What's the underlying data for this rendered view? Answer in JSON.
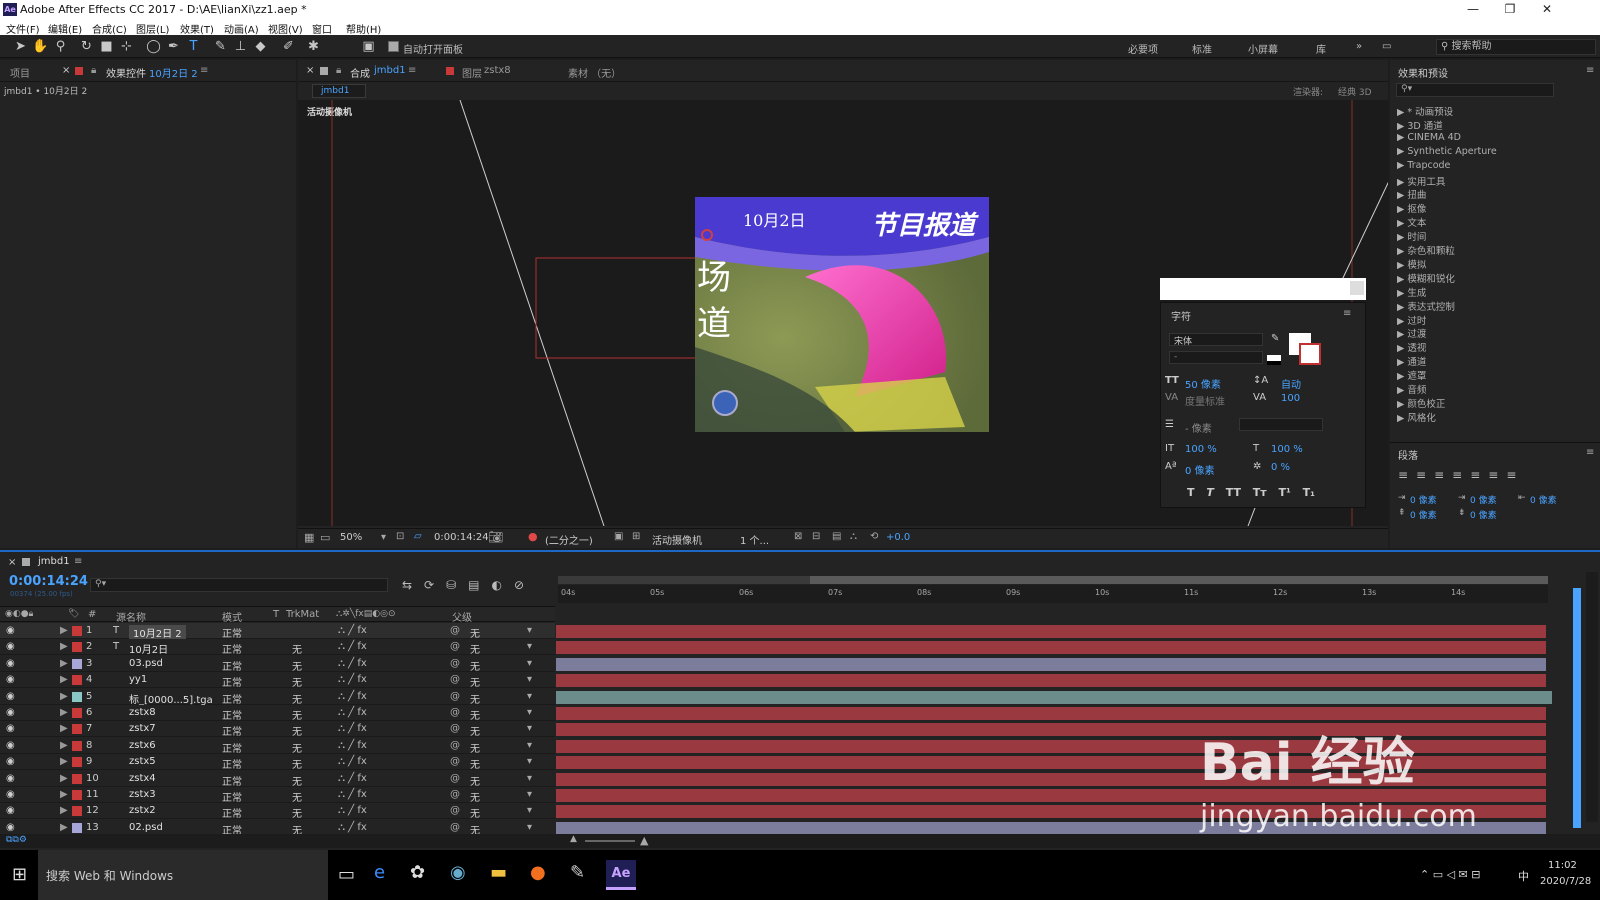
{
  "app": {
    "title": "Adobe After Effects CC 2017 - D:\\AE\\lianXi\\zz1.aep *",
    "logo": "Ae"
  },
  "menu": [
    "文件(F)",
    "编辑(E)",
    "合成(C)",
    "图层(L)",
    "效果(T)",
    "动画(A)",
    "视图(V)",
    "窗口",
    "帮助(H)"
  ],
  "toolbar": {
    "auto_open": "自动打开面板",
    "workspaces": [
      "必要项",
      "标准",
      "小屏幕",
      "库"
    ],
    "search_help": "搜索帮助"
  },
  "left_panel": {
    "tab_project": "项目",
    "tab_effects": "效果控件",
    "tab_effects_layer": "10月2日 2",
    "subtitle": "jmbd1 • 10月2日 2"
  },
  "viewer": {
    "tab_comp": "合成",
    "tab_comp_name": "jmbd1",
    "tab_layer": "图层",
    "tab_layer_name": "zstx8",
    "tab_footage": "素材 （无）",
    "comp_chip": "jmbd1",
    "renderer_label": "渲染器:",
    "renderer_value": "经典 3D",
    "camera_label": "活动摄像机",
    "frame_date": "10月2日",
    "frame_brand": "节目报道",
    "frame_chars": "场道"
  },
  "viewer_status": {
    "zoom": "50%",
    "timecode": "0:00:14:24",
    "resolution": "(二分之一)",
    "camera": "活动摄像机",
    "views": "1 个...",
    "exposure": "+0.0"
  },
  "effects_panel": {
    "title": "效果和预设",
    "items": [
      "* 动画预设",
      "3D 通道",
      "CINEMA 4D",
      "Synthetic Aperture",
      "Trapcode",
      "实用工具",
      "扭曲",
      "抠像",
      "文本",
      "时间",
      "杂色和颗粒",
      "模拟",
      "模糊和锐化",
      "生成",
      "表达式控制",
      "过时",
      "过渡",
      "透视",
      "通道",
      "遮罩",
      "音频",
      "颜色校正",
      "风格化"
    ]
  },
  "character_panel": {
    "title": "字符",
    "font": "宋体",
    "style": "-",
    "size": "50 像素",
    "leading": "自动",
    "kerning": "度量标准",
    "tracking": "100",
    "stroke": "- 像素",
    "vscale": "100 %",
    "hscale": "100 %",
    "baseline": "0 像素",
    "tsume": "0 %"
  },
  "paragraph_panel": {
    "title": "段落",
    "indent_left": "0 像素",
    "indent_first": "0 像素",
    "indent_right": "0 像素",
    "space_before": "0 像素",
    "space_after": "0 像素"
  },
  "timeline": {
    "comp_tab": "jmbd1",
    "timecode": "0:00:14:24",
    "frame_info": "00374 (25.00 fps)",
    "columns": {
      "num": "#",
      "name": "源名称",
      "mode": "模式",
      "t": "T",
      "trkmat": "TrkMat",
      "parent": "父级"
    },
    "ruler": [
      "04s",
      "05s",
      "06s",
      "07s",
      "08s",
      "09s",
      "10s",
      "11s",
      "12s",
      "13s",
      "14s"
    ],
    "layers": [
      {
        "num": "1",
        "type": "T",
        "name": "10月2日 2",
        "mode": "正常",
        "trkmat": "",
        "parent": "无",
        "color": "#c83a3a",
        "bar": "#9a3a40"
      },
      {
        "num": "2",
        "type": "T",
        "name": "10月2日",
        "mode": "正常",
        "trkmat": "无",
        "parent": "无",
        "color": "#c83a3a",
        "bar": "#9a3a40"
      },
      {
        "num": "3",
        "type": "",
        "name": "03.psd",
        "mode": "正常",
        "trkmat": "无",
        "parent": "无",
        "color": "#a6a6d8",
        "bar": "#7c7c9c"
      },
      {
        "num": "4",
        "type": "",
        "name": "yy1",
        "mode": "正常",
        "trkmat": "无",
        "parent": "无",
        "color": "#c83a3a",
        "bar": "#9a3a40"
      },
      {
        "num": "5",
        "type": "",
        "name": "标_[0000...5].tga",
        "mode": "正常",
        "trkmat": "无",
        "parent": "无",
        "color": "#8ac8c8",
        "bar": "#6c8c8c"
      },
      {
        "num": "6",
        "type": "",
        "name": "zstx8",
        "mode": "正常",
        "trkmat": "无",
        "parent": "无",
        "color": "#c83a3a",
        "bar": "#9a3a40"
      },
      {
        "num": "7",
        "type": "",
        "name": "zstx7",
        "mode": "正常",
        "trkmat": "无",
        "parent": "无",
        "color": "#c83a3a",
        "bar": "#9a3a40"
      },
      {
        "num": "8",
        "type": "",
        "name": "zstx6",
        "mode": "正常",
        "trkmat": "无",
        "parent": "无",
        "color": "#c83a3a",
        "bar": "#9a3a40"
      },
      {
        "num": "9",
        "type": "",
        "name": "zstx5",
        "mode": "正常",
        "trkmat": "无",
        "parent": "无",
        "color": "#c83a3a",
        "bar": "#9a3a40"
      },
      {
        "num": "10",
        "type": "",
        "name": "zstx4",
        "mode": "正常",
        "trkmat": "无",
        "parent": "无",
        "color": "#c83a3a",
        "bar": "#9a3a40"
      },
      {
        "num": "11",
        "type": "",
        "name": "zstx3",
        "mode": "正常",
        "trkmat": "无",
        "parent": "无",
        "color": "#c83a3a",
        "bar": "#9a3a40"
      },
      {
        "num": "12",
        "type": "",
        "name": "zstx2",
        "mode": "正常",
        "trkmat": "无",
        "parent": "无",
        "color": "#c83a3a",
        "bar": "#9a3a40"
      },
      {
        "num": "13",
        "type": "",
        "name": "02.psd",
        "mode": "正常",
        "trkmat": "无",
        "parent": "无",
        "color": "#a6a6d8",
        "bar": "#7c7c9c"
      }
    ]
  },
  "watermark": {
    "logo": "Bai 经验",
    "url": "jingyan.baidu.com"
  },
  "taskbar": {
    "search": "搜索 Web 和 Windows",
    "time": "11:02",
    "date": "2020/7/28",
    "ime": "中",
    "ae": "Ae"
  }
}
